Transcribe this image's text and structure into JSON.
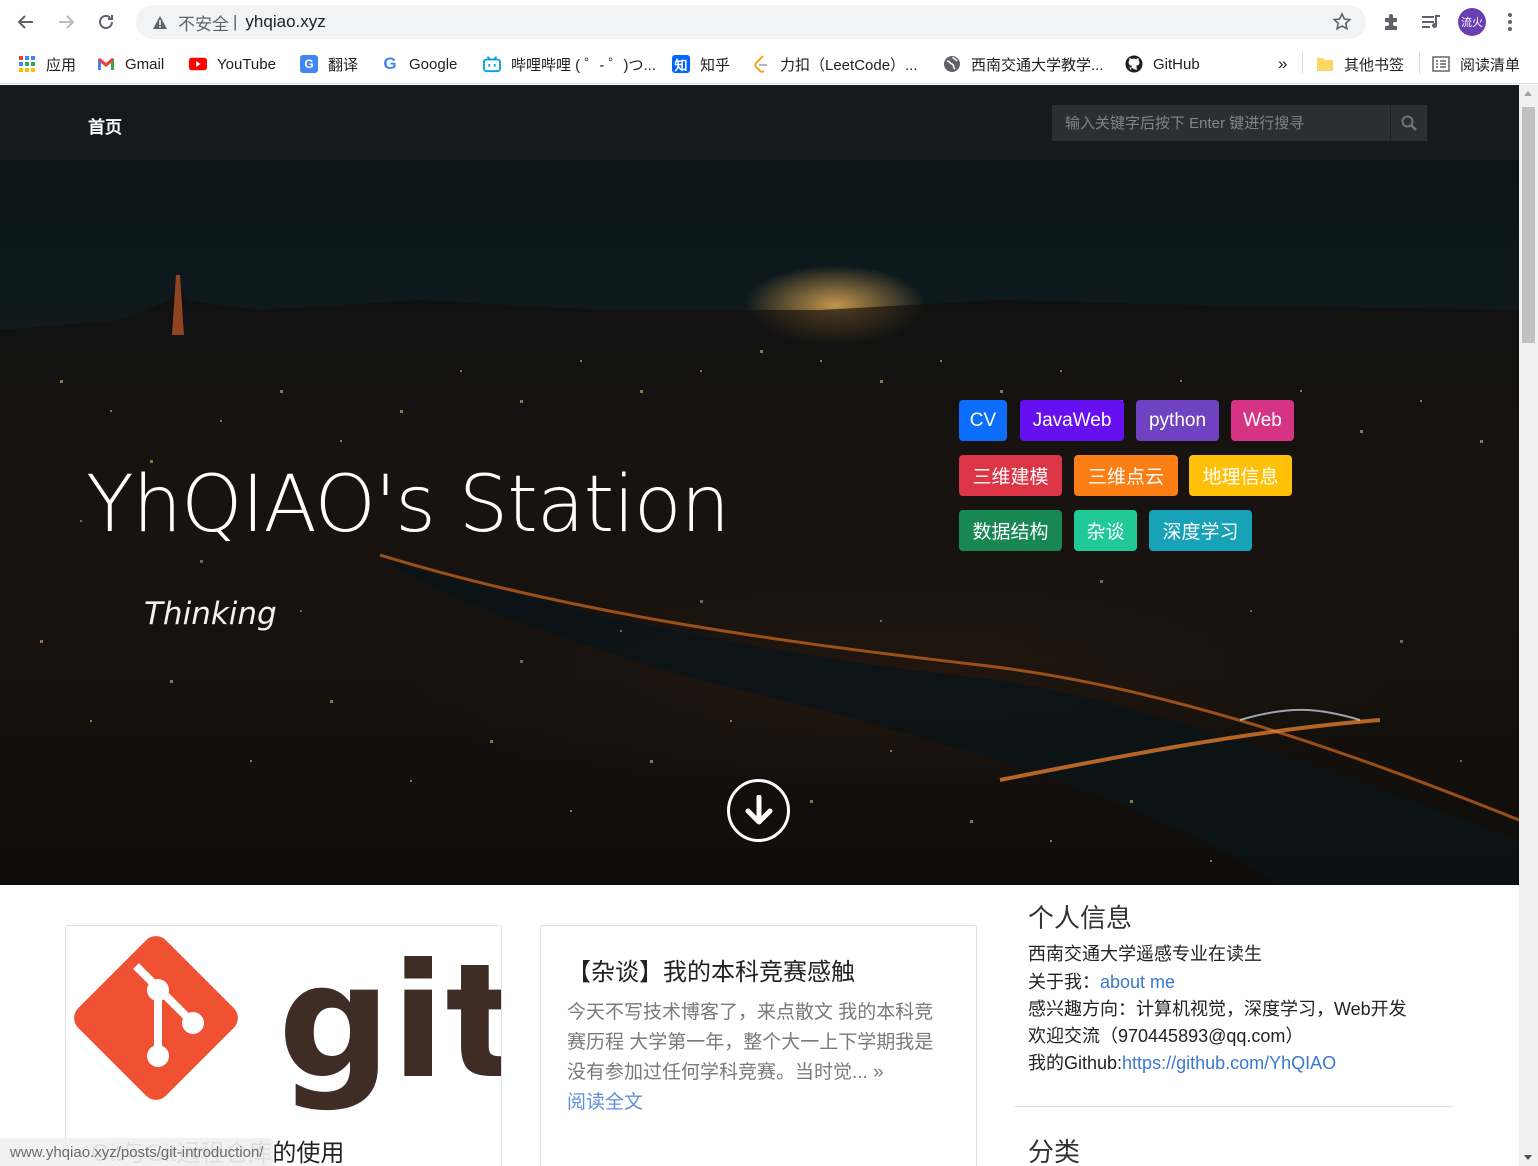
{
  "browser": {
    "security_label": "不安全",
    "url": "yhqiao.xyz",
    "profile_label": "流火"
  },
  "bookmarks": [
    {
      "label": "应用",
      "icon": "apps-grid-icon"
    },
    {
      "label": "Gmail",
      "icon": "gmail-icon"
    },
    {
      "label": "YouTube",
      "icon": "youtube-icon"
    },
    {
      "label": "翻译",
      "icon": "translate-icon"
    },
    {
      "label": "Google",
      "icon": "google-icon"
    },
    {
      "label": "哔哩哔哩 ( ゜- ゜)つ...",
      "icon": "bilibili-icon"
    },
    {
      "label": "知乎",
      "icon": "zhihu-icon"
    },
    {
      "label": "力扣（LeetCode）...",
      "icon": "leetcode-icon"
    },
    {
      "label": "西南交通大学教学...",
      "icon": "globe-icon"
    },
    {
      "label": "GitHub",
      "icon": "github-icon"
    }
  ],
  "bookmarks_overflow": "»",
  "other_bookmarks": "其他书签",
  "reading_list": "阅读清单",
  "site": {
    "nav_home": "首页",
    "search_placeholder": "输入关键字后按下 Enter 键进行搜寻"
  },
  "hero": {
    "title": "YhQIAO's Station",
    "subtitle": "Thinking"
  },
  "tags": [
    {
      "label": "CV",
      "color": "#0d6efd"
    },
    {
      "label": "JavaWeb",
      "color": "#6610f2"
    },
    {
      "label": "python",
      "color": "#6f42c1"
    },
    {
      "label": "Web",
      "color": "#d63384"
    },
    {
      "label": "三维建模",
      "color": "#dc3545"
    },
    {
      "label": "三维点云",
      "color": "#fd7e14"
    },
    {
      "label": "地理信息",
      "color": "#ffc107"
    },
    {
      "label": "数据结构",
      "color": "#198754"
    },
    {
      "label": "杂谈",
      "color": "#20c997"
    },
    {
      "label": "深度学习",
      "color": "#17a2b8"
    }
  ],
  "posts": [
    {
      "title": "Git与Git远程仓库的使用",
      "image_label": "git"
    },
    {
      "title": "【杂谈】我的本科竞赛感触",
      "excerpt": "今天不写技术博客了，来点散文 我的本科竞赛历程 大学第一年，整个大一上下学期我是没有参加过任何学科竞赛。当时觉... »",
      "read_more": "阅读全文"
    }
  ],
  "sidebar": {
    "heading": "个人信息",
    "line1": "西南交通大学遥感专业在读生",
    "about_prefix": "关于我：",
    "about_link": "about me",
    "interests": "感兴趣方向：计算机视觉，深度学习，Web开发",
    "contact": "欢迎交流（970445893@qq.com）",
    "github_prefix": "我的Github:",
    "github_link": "https://github.com/YhQIAO",
    "categories_heading": "分类"
  },
  "status_url": "www.yhqiao.xyz/posts/git-introduction/"
}
